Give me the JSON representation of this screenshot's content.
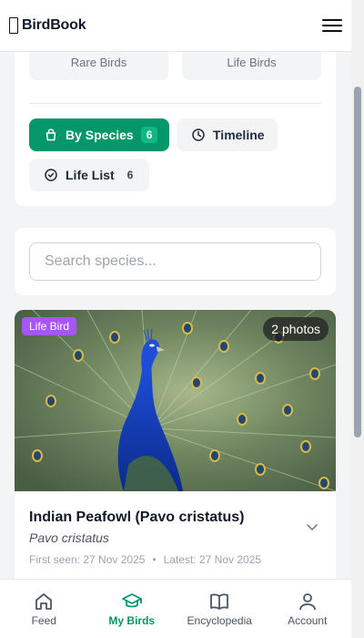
{
  "app": {
    "title": "BirdBook"
  },
  "stats": {
    "rare_label": "Rare Birds",
    "life_label": "Life Birds"
  },
  "tabs": [
    {
      "label": "By Species",
      "count": "6",
      "icon": "bag-icon",
      "active": true
    },
    {
      "label": "Timeline",
      "icon": "clock-icon"
    },
    {
      "label": "Life List",
      "count": "6",
      "icon": "check-circle-icon"
    }
  ],
  "search": {
    "placeholder": "Search species..."
  },
  "bird": {
    "badge": "Life Bird",
    "photos": "2 photos",
    "name": "Indian Peafowl (Pavo cristatus)",
    "scientific": "Pavo cristatus",
    "first_seen": "First seen: 27 Nov 2025",
    "latest": "Latest: 27 Nov 2025",
    "separator": "•"
  },
  "nav": [
    {
      "label": "Feed",
      "icon": "home-icon"
    },
    {
      "label": "My Birds",
      "icon": "graduation-cap-icon",
      "active": true
    },
    {
      "label": "Encyclopedia",
      "icon": "book-icon"
    },
    {
      "label": "Account",
      "icon": "user-icon"
    }
  ],
  "colors": {
    "accent": "#059669",
    "life_badge": "#a855f7"
  }
}
